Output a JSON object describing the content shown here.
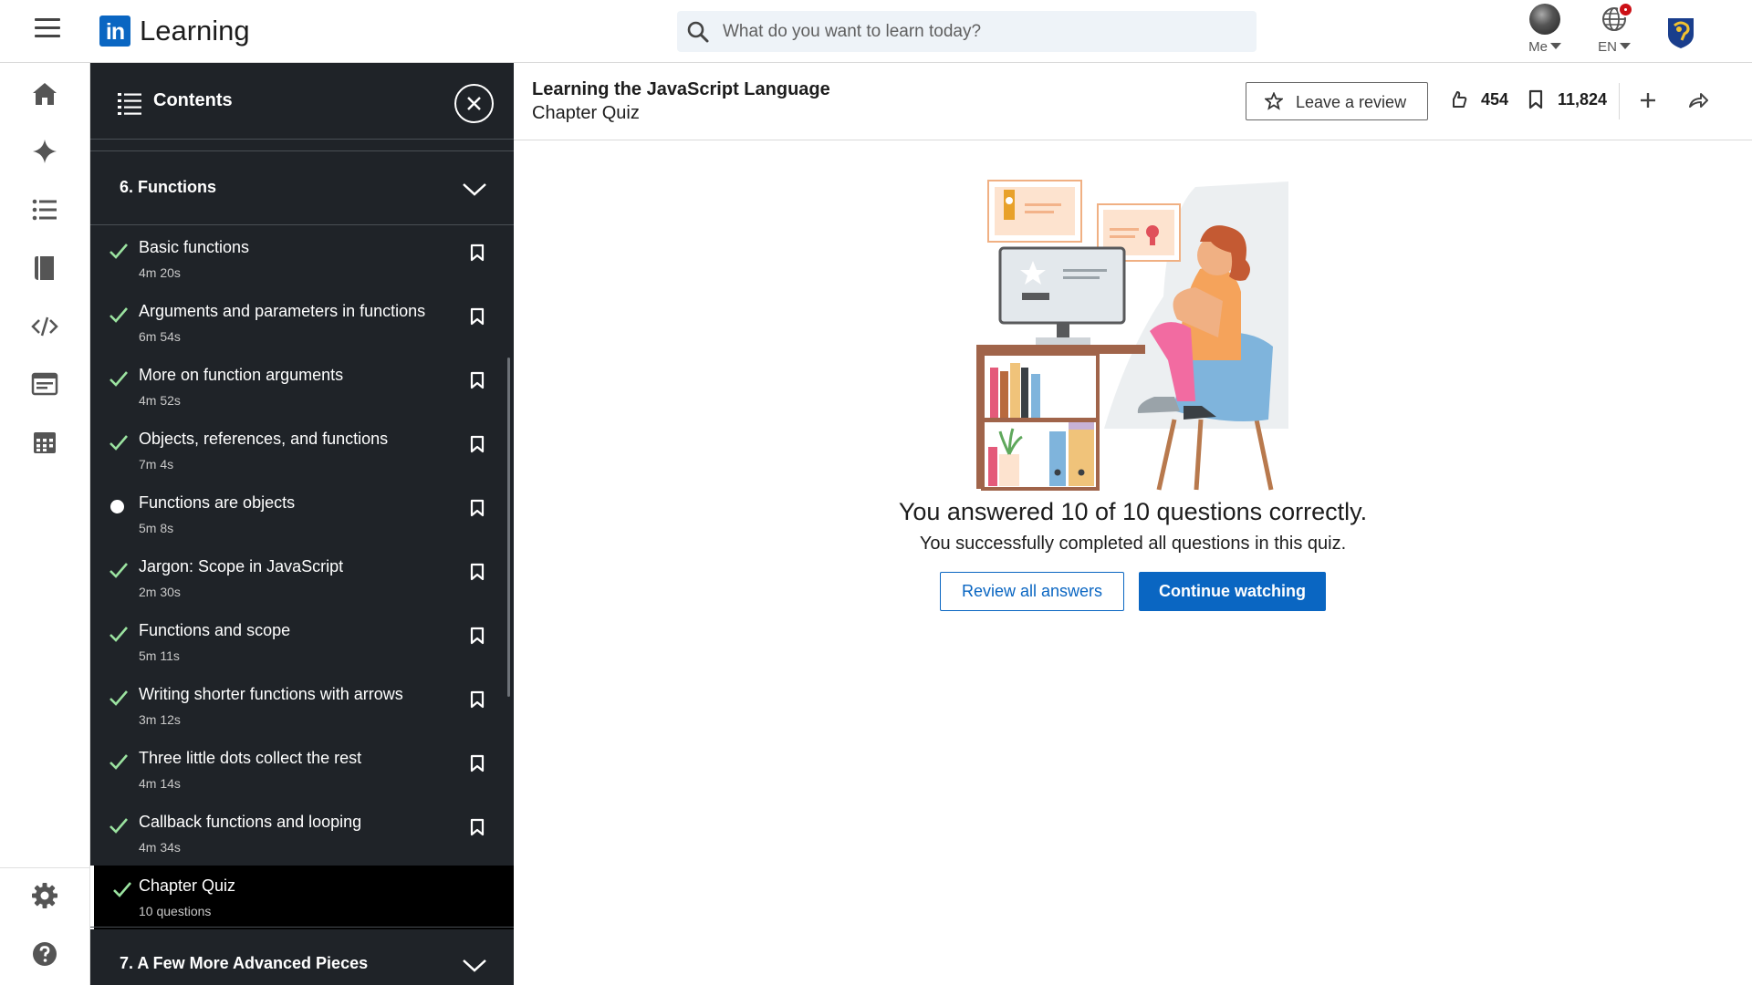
{
  "brand": {
    "logo_text": "in",
    "name": "Learning"
  },
  "search": {
    "placeholder": "What do you want to learn today?"
  },
  "nav": {
    "me_label": "Me",
    "lang_label": "EN"
  },
  "panel": {
    "title": "Contents",
    "section_current": "6. Functions",
    "section_next": "7. A Few More Advanced Pieces",
    "items": [
      {
        "title": "Basic functions",
        "meta": "4m 20s",
        "status": "complete"
      },
      {
        "title": "Arguments and parameters in functions",
        "meta": "6m 54s",
        "status": "complete"
      },
      {
        "title": "More on function arguments",
        "meta": "4m 52s",
        "status": "complete"
      },
      {
        "title": "Objects, references, and functions",
        "meta": "7m 4s",
        "status": "complete"
      },
      {
        "title": "Functions are objects",
        "meta": "5m 8s",
        "status": "in-progress"
      },
      {
        "title": "Jargon: Scope in JavaScript",
        "meta": "2m 30s",
        "status": "complete"
      },
      {
        "title": "Functions and scope",
        "meta": "5m 11s",
        "status": "complete"
      },
      {
        "title": "Writing shorter functions with arrows",
        "meta": "3m 12s",
        "status": "complete"
      },
      {
        "title": "Three little dots collect the rest",
        "meta": "4m 14s",
        "status": "complete"
      },
      {
        "title": "Callback functions and looping",
        "meta": "4m 34s",
        "status": "complete"
      },
      {
        "title": "Chapter Quiz",
        "meta": "10 questions",
        "status": "complete",
        "active": true
      }
    ]
  },
  "header": {
    "course_title": "Learning the JavaScript Language",
    "subtitle": "Chapter Quiz",
    "review_label": "Leave a review",
    "likes": "454",
    "saves": "11,824"
  },
  "result": {
    "title": "You answered 10 of 10 questions correctly.",
    "subtitle": "You successfully completed all questions in this quiz.",
    "review_button": "Review all answers",
    "continue_button": "Continue watching"
  },
  "colors": {
    "brand": "#0a66c2",
    "panel_bg": "#1f2328",
    "check": "#9be3a0",
    "notification": "#cc1016"
  }
}
